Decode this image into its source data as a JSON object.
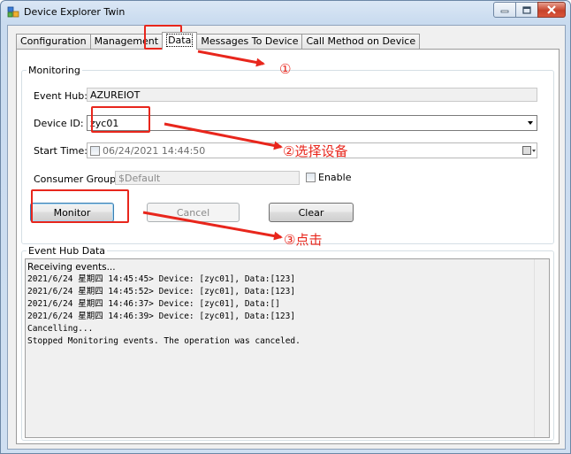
{
  "window": {
    "title": "Device Explorer Twin",
    "caption_buttons": [
      "minimize-icon",
      "maximize-icon",
      "close-icon"
    ]
  },
  "tabs": [
    {
      "label": "Configuration"
    },
    {
      "label": "Management"
    },
    {
      "label": "Data",
      "active": true
    },
    {
      "label": "Messages To Device"
    },
    {
      "label": "Call Method on Device"
    }
  ],
  "monitoring": {
    "title": "Monitoring",
    "event_hub_label": "Event Hub:",
    "event_hub_value": "AZUREIOT",
    "device_id_label": "Device ID:",
    "device_id_value": "zyc01",
    "start_time_label": "Start Time:",
    "start_time_value": "06/24/2021 14:44:50",
    "consumer_group_label": "Consumer Group:",
    "consumer_group_value": "$Default",
    "enable_label": "Enable",
    "monitor_button": "Monitor",
    "cancel_button": "Cancel",
    "clear_button": "Clear"
  },
  "event_hub_data": {
    "title": "Event Hub Data",
    "lines": [
      "Receiving events...",
      "2021/6/24 星期四 14:45:45> Device: [zyc01], Data:[123]",
      "2021/6/24 星期四 14:45:52> Device: [zyc01], Data:[123]",
      "2021/6/24 星期四 14:46:37> Device: [zyc01], Data:[]",
      "2021/6/24 星期四 14:46:39> Device: [zyc01], Data:[123]",
      "Cancelling...",
      "Stopped Monitoring events. The operation was canceled."
    ]
  },
  "annotations": {
    "step1": "①",
    "step2": "②选择设备",
    "step3": "③点击",
    "color": "#e8261c"
  }
}
